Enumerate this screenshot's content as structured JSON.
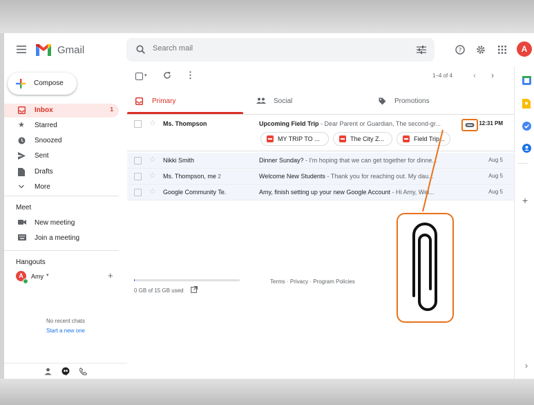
{
  "app": {
    "name": "Gmail",
    "avatar_letter": "A"
  },
  "search": {
    "placeholder": "Search mail"
  },
  "compose": {
    "label": "Compose"
  },
  "nav": [
    {
      "label": "Inbox",
      "count": "1",
      "icon": "inbox-icon"
    },
    {
      "label": "Starred",
      "icon": "star-icon"
    },
    {
      "label": "Snoozed",
      "icon": "clock-icon"
    },
    {
      "label": "Sent",
      "icon": "send-icon"
    },
    {
      "label": "Drafts",
      "icon": "draft-icon"
    },
    {
      "label": "More",
      "icon": "chevron-down-icon"
    }
  ],
  "meet": {
    "title": "Meet",
    "items": [
      {
        "label": "New meeting"
      },
      {
        "label": "Join a meeting"
      }
    ]
  },
  "hangouts": {
    "title": "Hangouts",
    "user": "Amy",
    "no_chats": "No recent chats",
    "start_link": "Start a new one"
  },
  "toolbar": {
    "pagination": "1–4 of 4"
  },
  "tabs": [
    {
      "label": "Primary",
      "active": true
    },
    {
      "label": "Social"
    },
    {
      "label": "Promotions"
    }
  ],
  "emails": [
    {
      "sender": "Ms. Thompson",
      "subject": "Upcoming Field Trip",
      "snippet": " - Dear Parent or Guardian, The second-gr...",
      "date": "12:31 PM",
      "unread": true,
      "has_attachment": true
    },
    {
      "sender": "Nikki Smith",
      "subject": "Dinner Sunday?",
      "snippet": " - I'm hoping that we can get together for dinne...",
      "date": "Aug 5",
      "unread": false
    },
    {
      "sender": "Ms. Thompson, me",
      "thread_count": "2",
      "subject": "Welcome New Students",
      "snippet": " - Thank you for reaching out. My dau...",
      "date": "Aug 5",
      "unread": false
    },
    {
      "sender": "Google Community Te.",
      "subject": "Amy, finish setting up your new Google Account",
      "snippet": " - Hi Amy, Wel...",
      "date": "Aug 5",
      "unread": false
    }
  ],
  "attachments": [
    {
      "name": "MY TRIP TO ..."
    },
    {
      "name": "The City Z..."
    },
    {
      "name": "Field Trip..."
    }
  ],
  "footer": {
    "storage": "0 GB of 15 GB used",
    "storage_fraction": 0.0,
    "links": "Terms · Privacy · Program Policies"
  },
  "colors": {
    "gmail_red": "#d93025",
    "highlight_orange": "#e8711a",
    "avatar": "#e8453c"
  }
}
